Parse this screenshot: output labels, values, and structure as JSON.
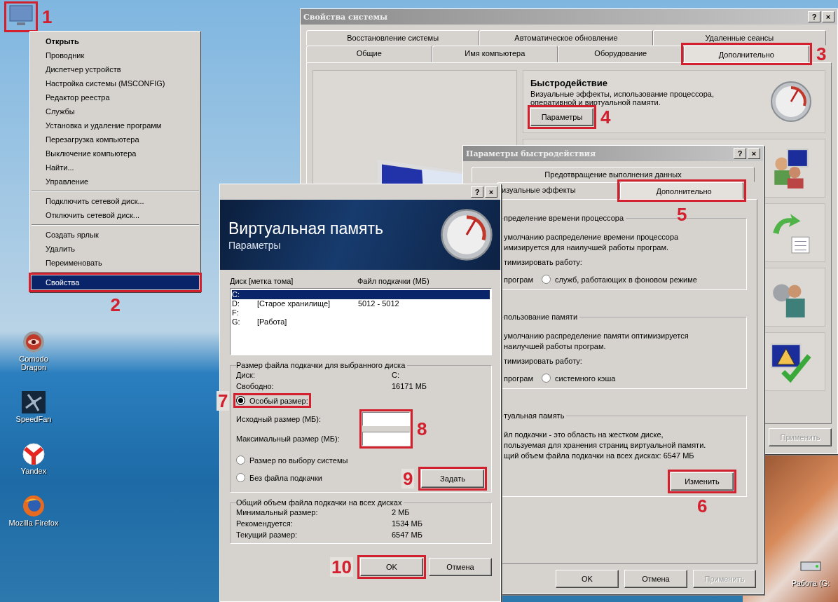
{
  "desktop_icons": [
    {
      "kind": "computer"
    },
    {
      "kind": "dragon",
      "label": "Comodo Dragon"
    },
    {
      "kind": "fan",
      "label": "SpeedFan"
    },
    {
      "kind": "yandex",
      "label": "Yandex"
    },
    {
      "kind": "firefox",
      "label": "Mozilla Firefox"
    },
    {
      "kind": "drive",
      "label": "Работа (G:"
    }
  ],
  "context_menu": {
    "items": [
      {
        "kind": "item",
        "label": "Открыть",
        "default": true,
        "selected": false
      },
      {
        "kind": "item",
        "label": "Проводник",
        "default": false,
        "selected": false
      },
      {
        "kind": "item",
        "label": "Диспетчер устройств",
        "default": false,
        "selected": false
      },
      {
        "kind": "item",
        "label": "Настройка системы (MSCONFIG)",
        "default": false,
        "selected": false
      },
      {
        "kind": "item",
        "label": "Редактор реестра",
        "default": false,
        "selected": false
      },
      {
        "kind": "item",
        "label": "Службы",
        "default": false,
        "selected": false
      },
      {
        "kind": "item",
        "label": "Установка и удаление программ",
        "default": false,
        "selected": false
      },
      {
        "kind": "item",
        "label": "Перезагрузка компьютера",
        "default": false,
        "selected": false
      },
      {
        "kind": "item",
        "label": "Выключение компьютера",
        "default": false,
        "selected": false
      },
      {
        "kind": "item",
        "label": "Найти...",
        "default": false,
        "selected": false
      },
      {
        "kind": "item",
        "label": "Управление",
        "default": false,
        "selected": false
      },
      {
        "kind": "separator"
      },
      {
        "kind": "item",
        "label": "Подключить сетевой диск...",
        "default": false,
        "selected": false
      },
      {
        "kind": "item",
        "label": "Отключить сетевой диск...",
        "default": false,
        "selected": false
      },
      {
        "kind": "separator"
      },
      {
        "kind": "item",
        "label": "Создать ярлык",
        "default": false,
        "selected": false
      },
      {
        "kind": "item",
        "label": "Удалить",
        "default": false,
        "selected": false
      },
      {
        "kind": "item",
        "label": "Переименовать",
        "default": false,
        "selected": false
      },
      {
        "kind": "separator"
      },
      {
        "kind": "item",
        "label": "Свойства",
        "default": false,
        "selected": true
      }
    ]
  },
  "system_properties": {
    "title": "Свойства системы",
    "title_buttons": [
      "?",
      "×"
    ],
    "tabs_row_1": [
      {
        "label": "Восстановление системы",
        "selected": false
      },
      {
        "label": "Автоматическое обновление",
        "selected": false
      },
      {
        "label": "Удаленные сеансы",
        "selected": false
      }
    ],
    "tabs_row_2": [
      {
        "label": "Общие",
        "selected": false
      },
      {
        "label": "Имя компьютера",
        "selected": false
      },
      {
        "label": "Оборудование",
        "selected": false
      },
      {
        "label": "Дополнительно",
        "selected": true
      }
    ],
    "performance": {
      "heading": "Быстродействие",
      "description": "Визуальные эффекты, использование процессора, оперативной и виртуальной памяти.",
      "button": "Параметры"
    },
    "buttons": [
      {
        "label": "Применить",
        "disabled": true
      }
    ]
  },
  "performance_options": {
    "title": "Параметры быстродействия",
    "title_buttons": [
      "?",
      "×"
    ],
    "tabs_row_1": [
      {
        "label": "Предотвращение выполнения данных",
        "selected": false
      }
    ],
    "tabs_row_2": [
      {
        "label": "изуальные эффекты",
        "selected": false
      },
      {
        "label": "Дополнительно",
        "selected": true
      }
    ],
    "groups": [
      {
        "title": "пределение времени процессора",
        "lines": [
          "умолчанию распределение времени процессора",
          "имизируется для наилучшей работы програм."
        ],
        "prompt": "тимизировать работу:",
        "options": [
          {
            "label": "програм"
          },
          {
            "label": "служб, работающих в фоновом режиме",
            "selected": false
          }
        ]
      },
      {
        "title": "пользование памяти",
        "lines": [
          "умолчанию распределение памяти оптимизируется",
          "наилучшей работы програм."
        ],
        "prompt": "тимизировать работу:",
        "options": [
          {
            "label": "програм"
          },
          {
            "label": "системного кэша",
            "selected": false
          }
        ]
      },
      {
        "title": "туальная память",
        "lines": [
          "йл подкачки - это область на жестком диске,",
          "пользуемая для хранения страниц виртуальной памяти.",
          "щий объем файла подкачки на всех дисках:  6547 МБ"
        ],
        "button": "Изменить"
      }
    ],
    "buttons": [
      {
        "label": "OK",
        "disabled": false
      },
      {
        "label": "Отмена",
        "disabled": false
      },
      {
        "label": "Применить",
        "disabled": true
      }
    ]
  },
  "virtual_memory": {
    "title_buttons": [
      "?",
      "×"
    ],
    "heading": "Виртуальная память",
    "subheading": "Параметры",
    "list": {
      "columns": [
        "Диск [метка тома]",
        "Файл подкачки (МБ)"
      ],
      "rows": [
        {
          "drive": "C:",
          "selected": true
        },
        {
          "drive": "D:",
          "label": "[Старое хранилище]",
          "size": "5012 - 5012",
          "selected": false
        },
        {
          "drive": "F:",
          "selected": false
        },
        {
          "drive": "G:",
          "label": "[Работа]",
          "selected": false
        }
      ]
    },
    "selected_drive": {
      "title": "Размер файла подкачки для выбранного диска",
      "info": [
        {
          "label": "Диск:",
          "value": "C:"
        },
        {
          "label": "Свободно:",
          "value": "16171 МБ"
        }
      ],
      "items": [
        {
          "kind": "radio",
          "label": "Особый размер:",
          "selected": true
        },
        {
          "kind": "field",
          "label": "Исходный размер (МБ):"
        },
        {
          "kind": "field",
          "label": "Максимальный размер (МБ):"
        },
        {
          "kind": "radio",
          "label": "Размер по выбору системы",
          "selected": false
        },
        {
          "kind": "radio",
          "label": "Без файла подкачки",
          "selected": false
        }
      ],
      "button": "Задать"
    },
    "totals": {
      "title": "Общий объем файла подкачки на всех дисках",
      "rows": [
        {
          "label": "Минимальный размер:",
          "value": "2 МБ"
        },
        {
          "label": "Рекомендуется:",
          "value": "1534 МБ"
        },
        {
          "label": "Текущий размер:",
          "value": "6547 МБ"
        }
      ]
    },
    "buttons": [
      {
        "label": "OK"
      },
      {
        "label": "Отмена"
      }
    ]
  },
  "annotations": [
    {
      "label": "1"
    },
    {
      "label": "2"
    },
    {
      "label": "3"
    },
    {
      "label": "4"
    },
    {
      "label": "5"
    },
    {
      "label": "6"
    },
    {
      "label": "7"
    },
    {
      "label": "8"
    },
    {
      "label": "9"
    },
    {
      "label": "10"
    }
  ]
}
